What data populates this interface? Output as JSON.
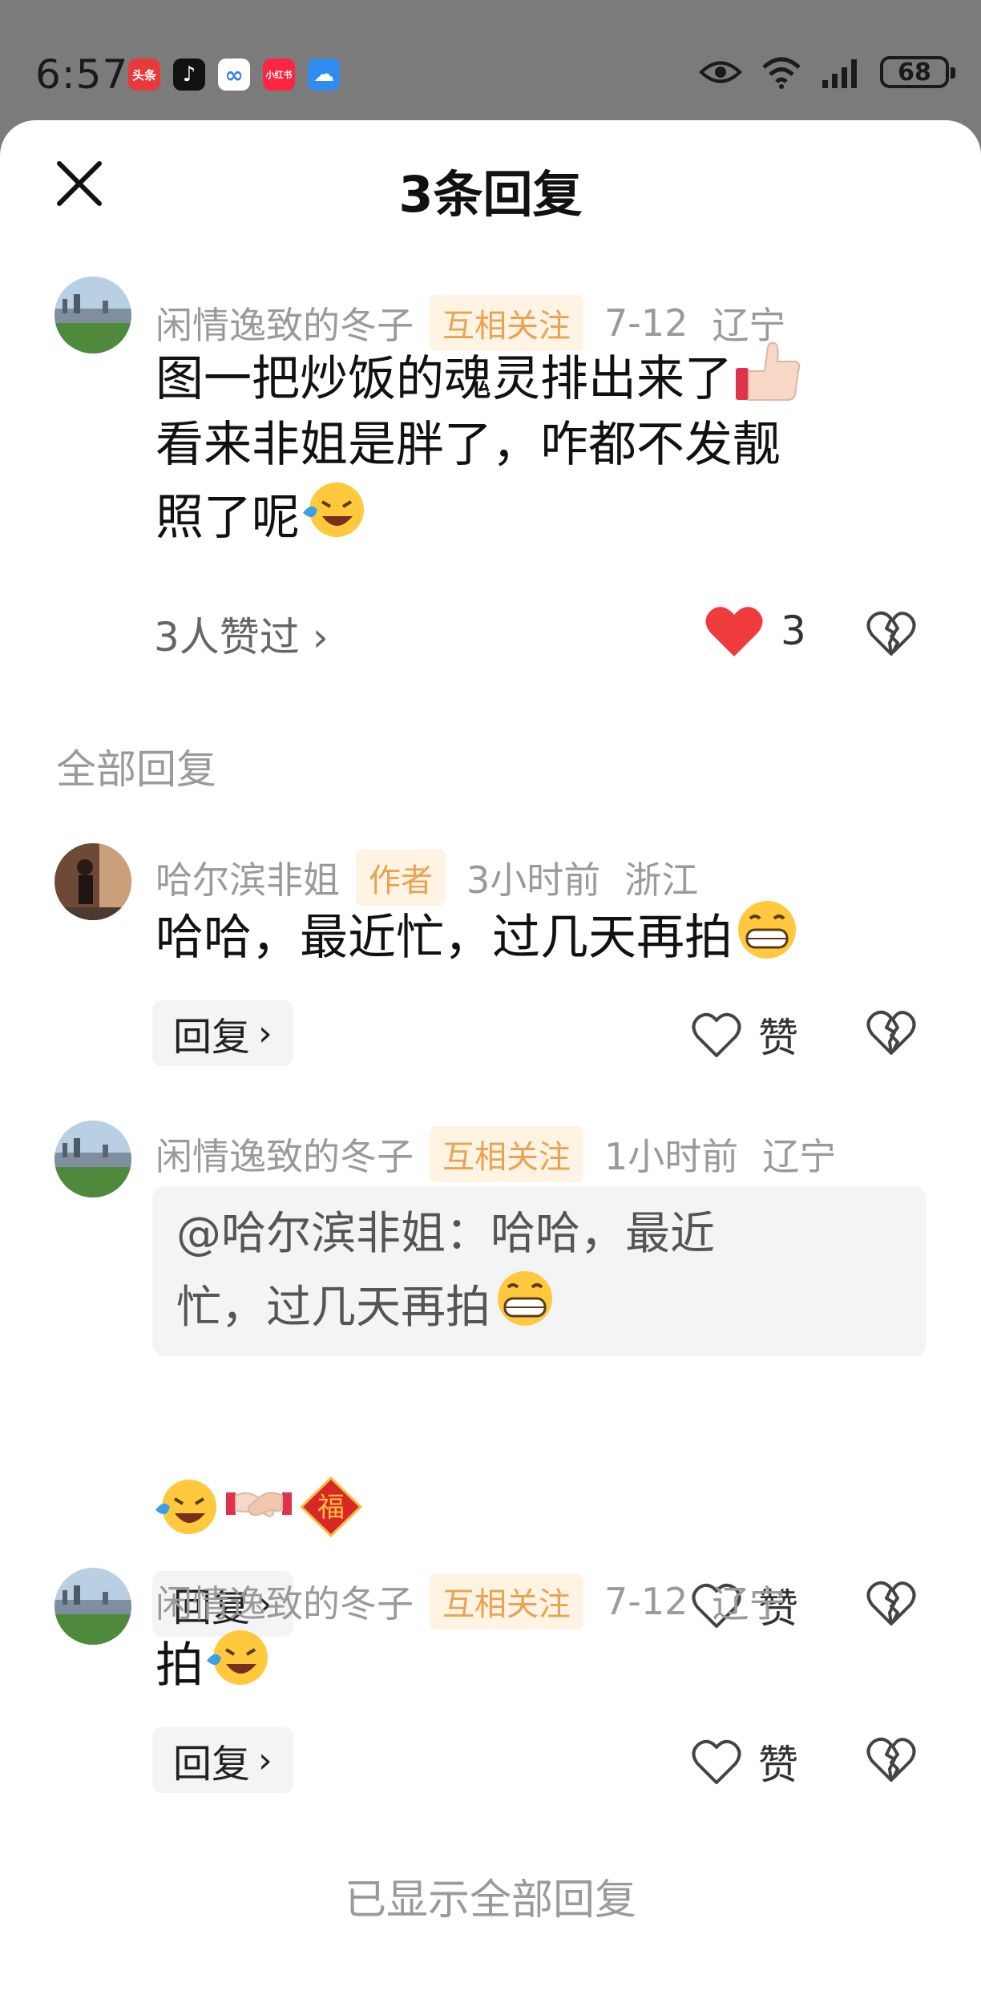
{
  "status_bar": {
    "time": "6:57",
    "apps": [
      {
        "name": "toutiao-icon",
        "label": "头条",
        "color": "#e83a3a"
      },
      {
        "name": "douyin-icon",
        "label": "♪",
        "color": "#111111"
      },
      {
        "name": "baidu-netdisk-icon",
        "label": "∞",
        "color": "#3b7df0"
      },
      {
        "name": "xiaohongshu-icon",
        "label": "小红书",
        "color": "#ff2442"
      },
      {
        "name": "weather-icon",
        "label": "☁",
        "color": "#2e8cf0"
      }
    ],
    "battery": "68"
  },
  "header": {
    "title": "3条回复"
  },
  "main_comment": {
    "author": "闲情逸致的冬子",
    "badge": "互相关注",
    "time": "7-12",
    "location": "辽宁",
    "text_line1": "图一把炒饭的魂灵排出来了",
    "text_line2": "看来非姐是胖了，咋都不发靓",
    "text_line3": "照了呢",
    "likers": "3人赞过",
    "like_count": "3"
  },
  "section_label": "全部回复",
  "replies": [
    {
      "author": "哈尔滨非姐",
      "badge": "作者",
      "time": "3小时前",
      "location": "浙江",
      "text": "哈哈，最近忙，过几天再拍",
      "reply_label": "回复",
      "like_label": "赞"
    },
    {
      "author": "闲情逸致的冬子",
      "badge": "互相关注",
      "time": "1小时前",
      "location": "辽宁",
      "quote_line1": "@哈尔滨非姐：哈哈，最近",
      "quote_line2": "忙，过几天再拍",
      "reply_label": "回复",
      "like_label": "赞"
    },
    {
      "author": "闲情逸致的冬子",
      "badge": "互相关注",
      "time": "7-12",
      "location": "辽宁",
      "text": "拍",
      "reply_label": "回复",
      "like_label": "赞"
    }
  ],
  "footer": "已显示全部回复",
  "colors": {
    "heart_red": "#ef3b3b",
    "badge_bg": "#fff3e4",
    "badge_text": "#e8a451"
  }
}
